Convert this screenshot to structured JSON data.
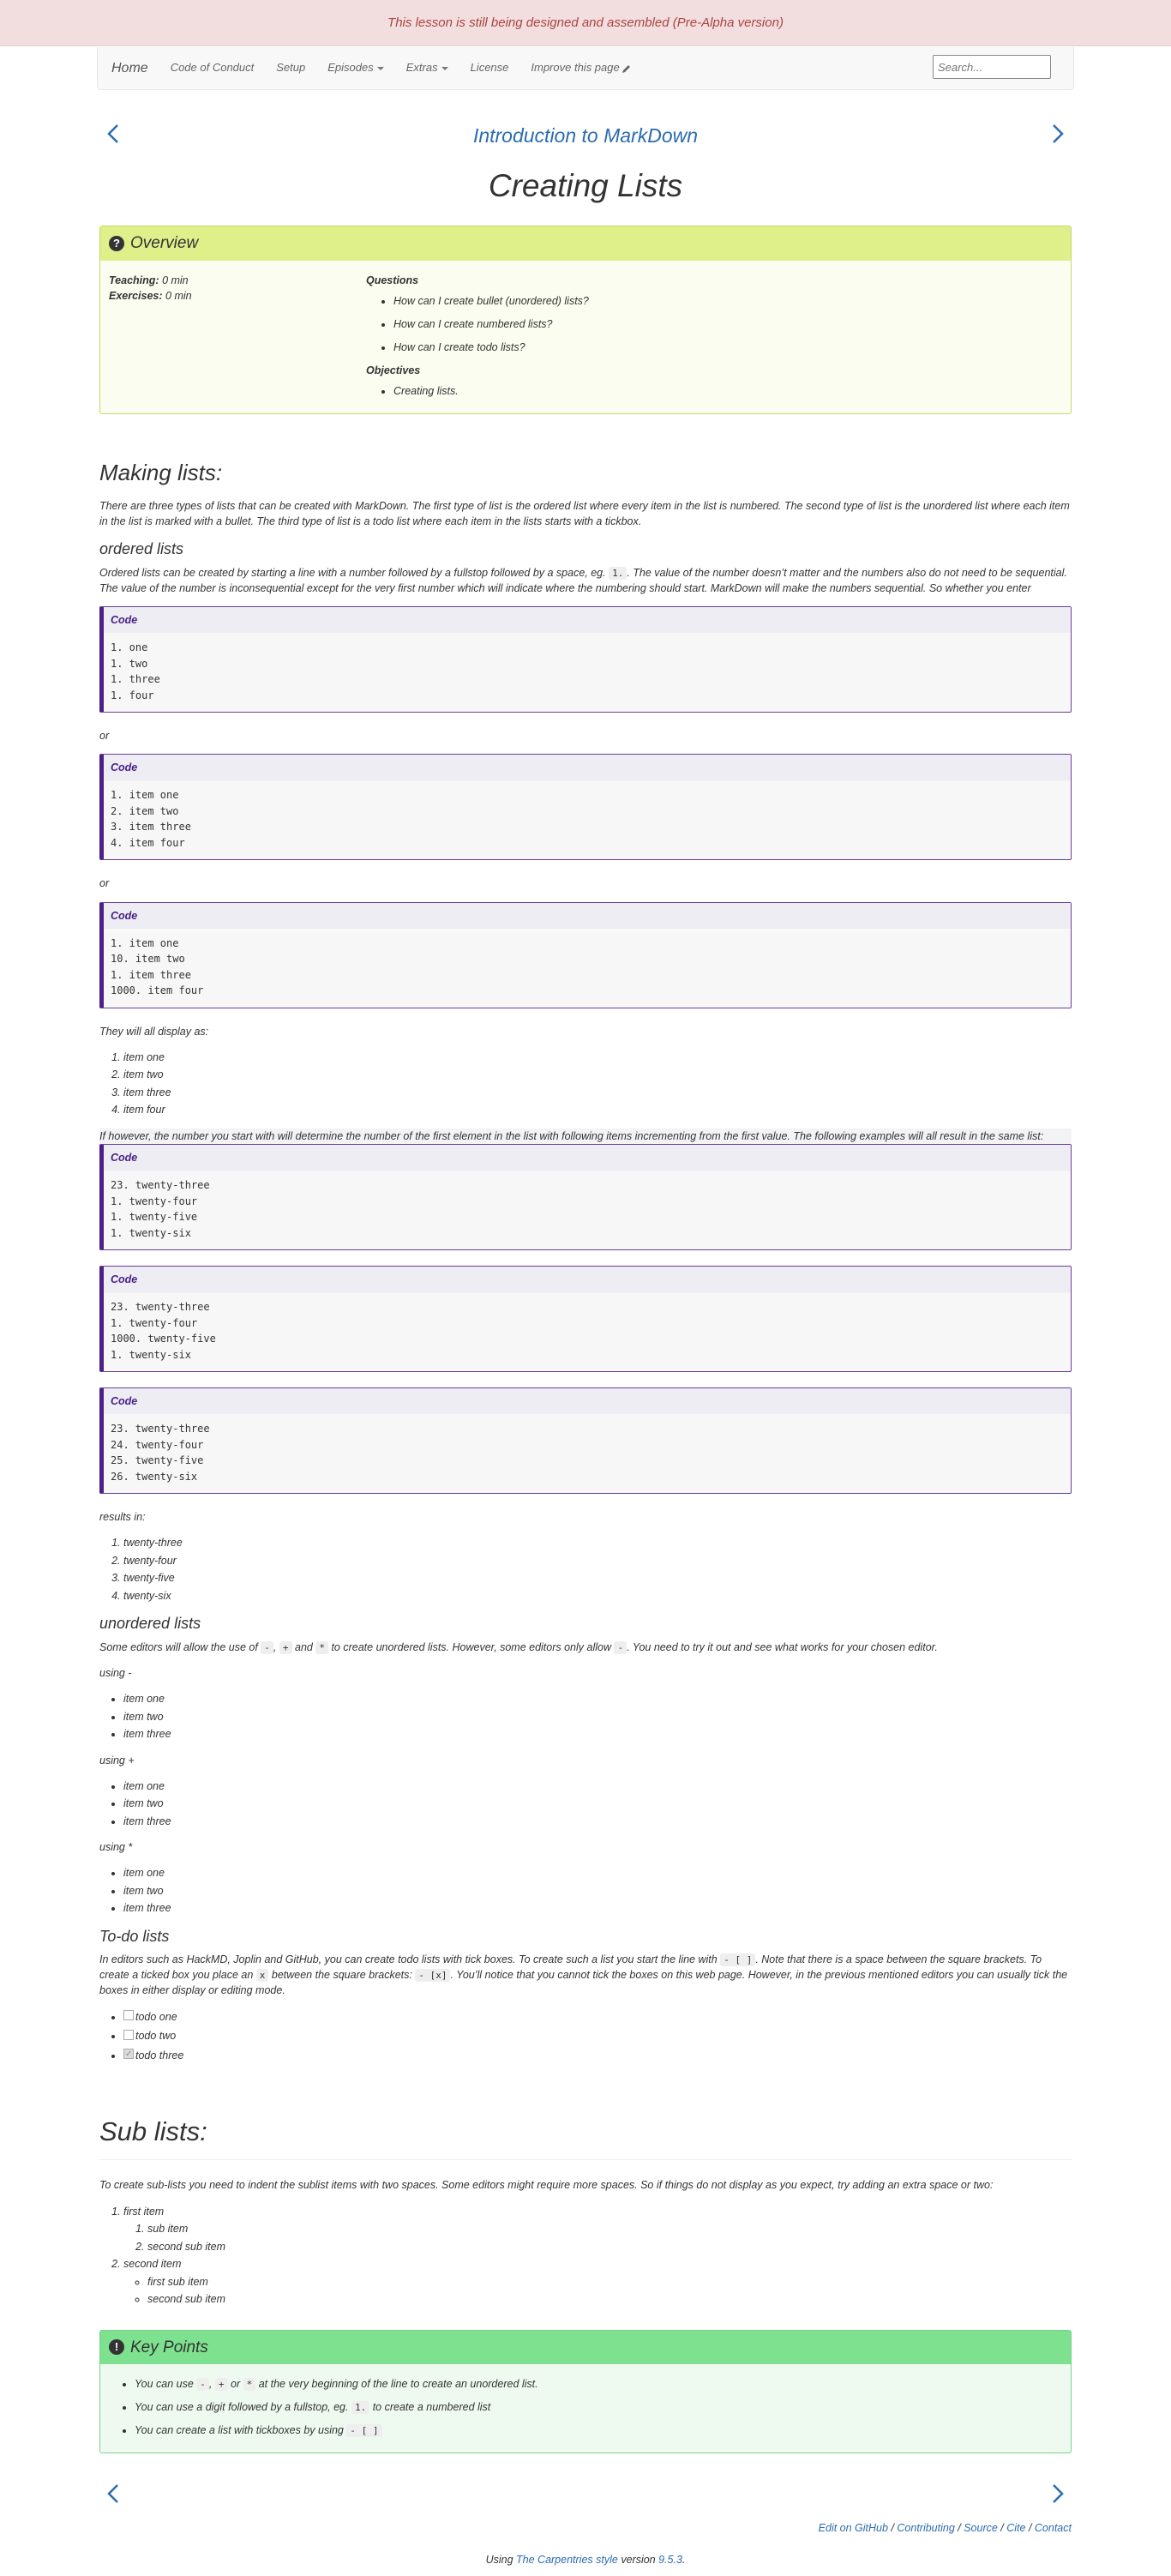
{
  "banner": {
    "text": "This lesson is still being designed and assembled (Pre-Alpha version)"
  },
  "navbar": {
    "home": "Home",
    "conduct": "Code of Conduct",
    "setup": "Setup",
    "episodes": "Episodes",
    "extras": "Extras",
    "license": "License",
    "improve": "Improve this page",
    "search_placeholder": "Search..."
  },
  "lesson": {
    "title": "Introduction to MarkDown"
  },
  "page": {
    "title": "Creating Lists"
  },
  "overview": {
    "heading": "Overview",
    "teaching_label": "Teaching:",
    "teaching_value": "0 min",
    "exercises_label": "Exercises:",
    "exercises_value": "0 min",
    "questions_label": "Questions",
    "questions": [
      "How can I create bullet (unordered) lists?",
      "How can I create numbered lists?",
      "How can I create todo lists?"
    ],
    "objectives_label": "Objectives",
    "objectives": [
      "Creating lists."
    ]
  },
  "making": {
    "heading": "Making lists:",
    "intro": "There are three types of lists that can be created with MarkDown. The first type of list is the ordered list where every item in the list is numbered. The second type of list is the unordered list where each item in the list is marked with a bullet. The third type of list is a todo list where each item in the lists starts with a tickbox.",
    "ordered_heading": "ordered lists",
    "ordered_p1": "Ordered lists can be created by starting a line with a number followed by a fullstop followed by a space, eg.",
    "ordered_code": "1.",
    "ordered_p2": ". The value of the number doesn’t matter and the numbers also do not need to be sequential. The value of the number is inconsequential except for the very first number which will indicate where the numbering should start. MarkDown will make the numbers sequential. So whether you enter",
    "code_label": "Code",
    "code1": "1. one\n1. two\n1. three\n1. four",
    "or1": "or",
    "code2": "1. item one\n2. item two\n3. item three\n4. item four",
    "or2": "or",
    "code3": "1. item one\n10. item two\n1. item three\n1000. item four",
    "display_as": "They will all display as:",
    "display_items": [
      "item one",
      "item two",
      "item three",
      "item four"
    ],
    "however": "If however, the number you start with will determine the number of the first element in the list with following items incrementing from the first value. The following examples will all result in the same list:",
    "code4": "23. twenty-three\n1. twenty-four\n1. twenty-five\n1. twenty-six",
    "code5": "23. twenty-three\n1. twenty-four\n1000. twenty-five\n1. twenty-six",
    "code6": "23. twenty-three\n24. twenty-four\n25. twenty-five\n26. twenty-six",
    "results_in": "results in:",
    "result_items": [
      "twenty-three",
      "twenty-four",
      "twenty-five",
      "twenty-six"
    ],
    "result_start": 1,
    "unordered_heading": "unordered lists",
    "unordered_p1": "Some editors will allow the use of",
    "unordered_c1": "-",
    "unordered_p2": ",",
    "unordered_c2": "+",
    "unordered_p3": "and",
    "unordered_c3": "*",
    "unordered_p4": "to create unordered lists. However, some editors only allow",
    "unordered_c4": "-",
    "unordered_p5": ". You need to try it out and see what works for your chosen editor.",
    "using_dash": "using -",
    "using_plus": "using +",
    "using_star": "using *",
    "items": [
      "item one",
      "item two",
      "item three"
    ],
    "todo_heading": "To-do lists",
    "todo_p1": "In editors such as HackMD, Joplin and GitHub, you can create todo lists with tick boxes. To create such a list you start the line with",
    "todo_c1": "- [ ]",
    "todo_p2": ". Note that there is a space between the square brackets. To create a ticked box you place an",
    "todo_c2": "x",
    "todo_p3": "between the square brackets:",
    "todo_c3": "- [x]",
    "todo_p4": ". You’ll notice that you cannot tick the boxes on this web page. However, in the previous mentioned editors you can usually tick the boxes in either display or editing mode.",
    "todo_items": [
      "todo one",
      "todo two",
      "todo three"
    ]
  },
  "sublists": {
    "heading": "Sub lists:",
    "intro": "To create sub-lists you need to indent the sublist items with two spaces. Some editors might require more spaces. So if things do not display as you expect, try adding an extra space or two:",
    "first": "first item",
    "first_subs": [
      "sub item",
      "second sub item"
    ],
    "second": "second item",
    "second_subs": [
      "first sub item",
      "second sub item"
    ]
  },
  "keypoints": {
    "heading": "Key Points",
    "kp1_a": "You can use",
    "kp1_c1": "-",
    "kp1_b": ",",
    "kp1_c2": "+",
    "kp1_c": "or",
    "kp1_c3": "*",
    "kp1_d": "at the very beginning of the line to create an unordered list.",
    "kp2_a": "You can use a digit followed by a fullstop, eg.",
    "kp2_c1": "1.",
    "kp2_b": "to create a numbered list",
    "kp3_a": "You can create a list with tickboxes by using",
    "kp3_c1": "- [ ]"
  },
  "footer": {
    "edit": "Edit on GitHub",
    "sep": " / ",
    "contributing": "Contributing",
    "source": "Source",
    "cite": "Cite",
    "contact": "Contact",
    "using": "Using",
    "style": "The Carpentries style",
    "version_word": "version",
    "version": "9.5.3",
    "period": "."
  },
  "colors": {
    "accent": "#2b6cb0",
    "code_border": "#4b2187",
    "overview": "#dfef8a",
    "keypoints": "#7ee18f",
    "banner": "#f2dede"
  }
}
